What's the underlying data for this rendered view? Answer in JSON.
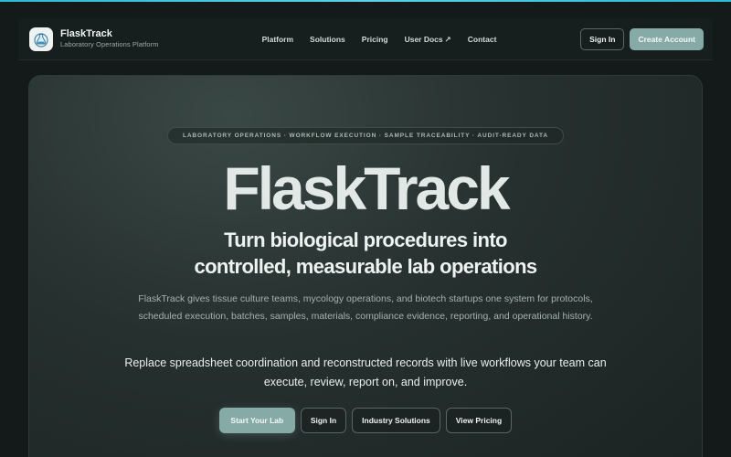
{
  "brand": {
    "name": "FlaskTrack",
    "tagline": "Laboratory Operations Platform",
    "logo_icon": "flask-icon"
  },
  "nav": {
    "items": [
      {
        "label": "Platform"
      },
      {
        "label": "Solutions"
      },
      {
        "label": "Pricing"
      },
      {
        "label": "User Docs",
        "external_icon": "external-link-icon"
      },
      {
        "label": "Contact"
      }
    ],
    "external_glyph": "↗",
    "sign_in_label": "Sign In",
    "create_account_label": "Create Account"
  },
  "hero": {
    "pill": "LABORATORY OPERATIONS · WORKFLOW EXECUTION · SAMPLE TRACEABILITY · AUDIT-READY DATA",
    "title": "FlaskTrack",
    "subtitle_line1": "Turn biological procedures into",
    "subtitle_line2": "controlled, measurable lab operations",
    "description": "FlaskTrack gives tissue culture teams, mycology operations, and biotech startups one system for protocols, scheduled execution, batches, samples, materials, compliance evidence, reporting, and operational history.",
    "cta_text": "Replace spreadsheet coordination and reconstructed records with live workflows your team can execute, review, report on, and improve.",
    "buttons": {
      "start": "Start Your Lab",
      "sign_in": "Sign In",
      "industry": "Industry Solutions",
      "pricing": "View Pricing"
    }
  },
  "colors": {
    "accent": "#86aaa5",
    "top_line": "#2fb8d6",
    "background": "#141a1a"
  }
}
